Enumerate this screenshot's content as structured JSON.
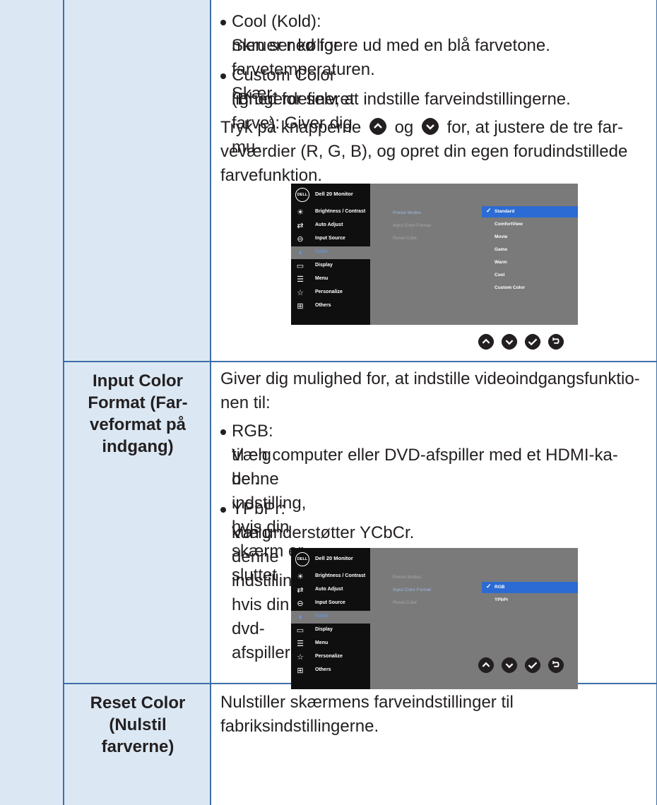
{
  "section1": {
    "bullet_cool": "Cool (Kold): Skruer ned for farvetemperaturen. Skær-",
    "bullet_cool_2": "men ser køligere ud med en blå farvetone.",
    "bullet_custom": "Custom Color (Brugerdefineret farve): Giver dig mu-",
    "bullet_custom_2": "lighed for selv, at indstille farveindstillingerne.",
    "para_a": "Tryk på knapperne",
    "para_og": "og",
    "para_b": "for, at justere de tre far-",
    "para_2": "veværdier (R, G, B), og opret din egen forudindstillede",
    "para_3": "farvefunktion."
  },
  "osd": {
    "title": "Dell 20 Monitor",
    "logo": "DELL",
    "menu": [
      "Brightness / Contrast",
      "Auto Adjust",
      "Input Source",
      "Color",
      "Display",
      "Menu",
      "Personalize",
      "Others"
    ],
    "submenu": [
      "Preset Modes",
      "Input Color Format",
      "Reset Color"
    ],
    "preset_options": [
      "Standard",
      "ComfortView",
      "Movie",
      "Game",
      "Warm",
      "Cool",
      "Custom Color"
    ],
    "format_options": [
      "RGB",
      "YPbPr"
    ]
  },
  "section2": {
    "label_1": "Input Color",
    "label_2": "Format (Far-",
    "label_3": "veformat på",
    "label_4": "indgang)",
    "intro_1": "Giver dig mulighed for, at indstille videoindgangsfunktio-",
    "intro_2": "nen til:",
    "bullet_rgb_1": "RGB: Vælg denne indstilling, hvis din skærm er sluttet",
    "bullet_rgb_2": "til en computer eller DVD-afspiller med et HDMI-ka-",
    "bullet_rgb_3": "bel.",
    "bullet_ypbpr_1": "YPbPr: Vælg denne indstilling, hvis din dvd-afspiller",
    "bullet_ypbpr_2": "kun understøtter YCbCr."
  },
  "section3": {
    "label_1": "Reset Color",
    "label_2": "(Nulstil",
    "label_3": "farverne)",
    "desc_1": "Nulstiller skærmens farveindstillinger til",
    "desc_2": "fabriksindstillingerne."
  },
  "colors": {
    "border": "#3e6fa8",
    "cell_bg": "#dbe8f4",
    "osd_highlight": "#2c6bd4"
  }
}
